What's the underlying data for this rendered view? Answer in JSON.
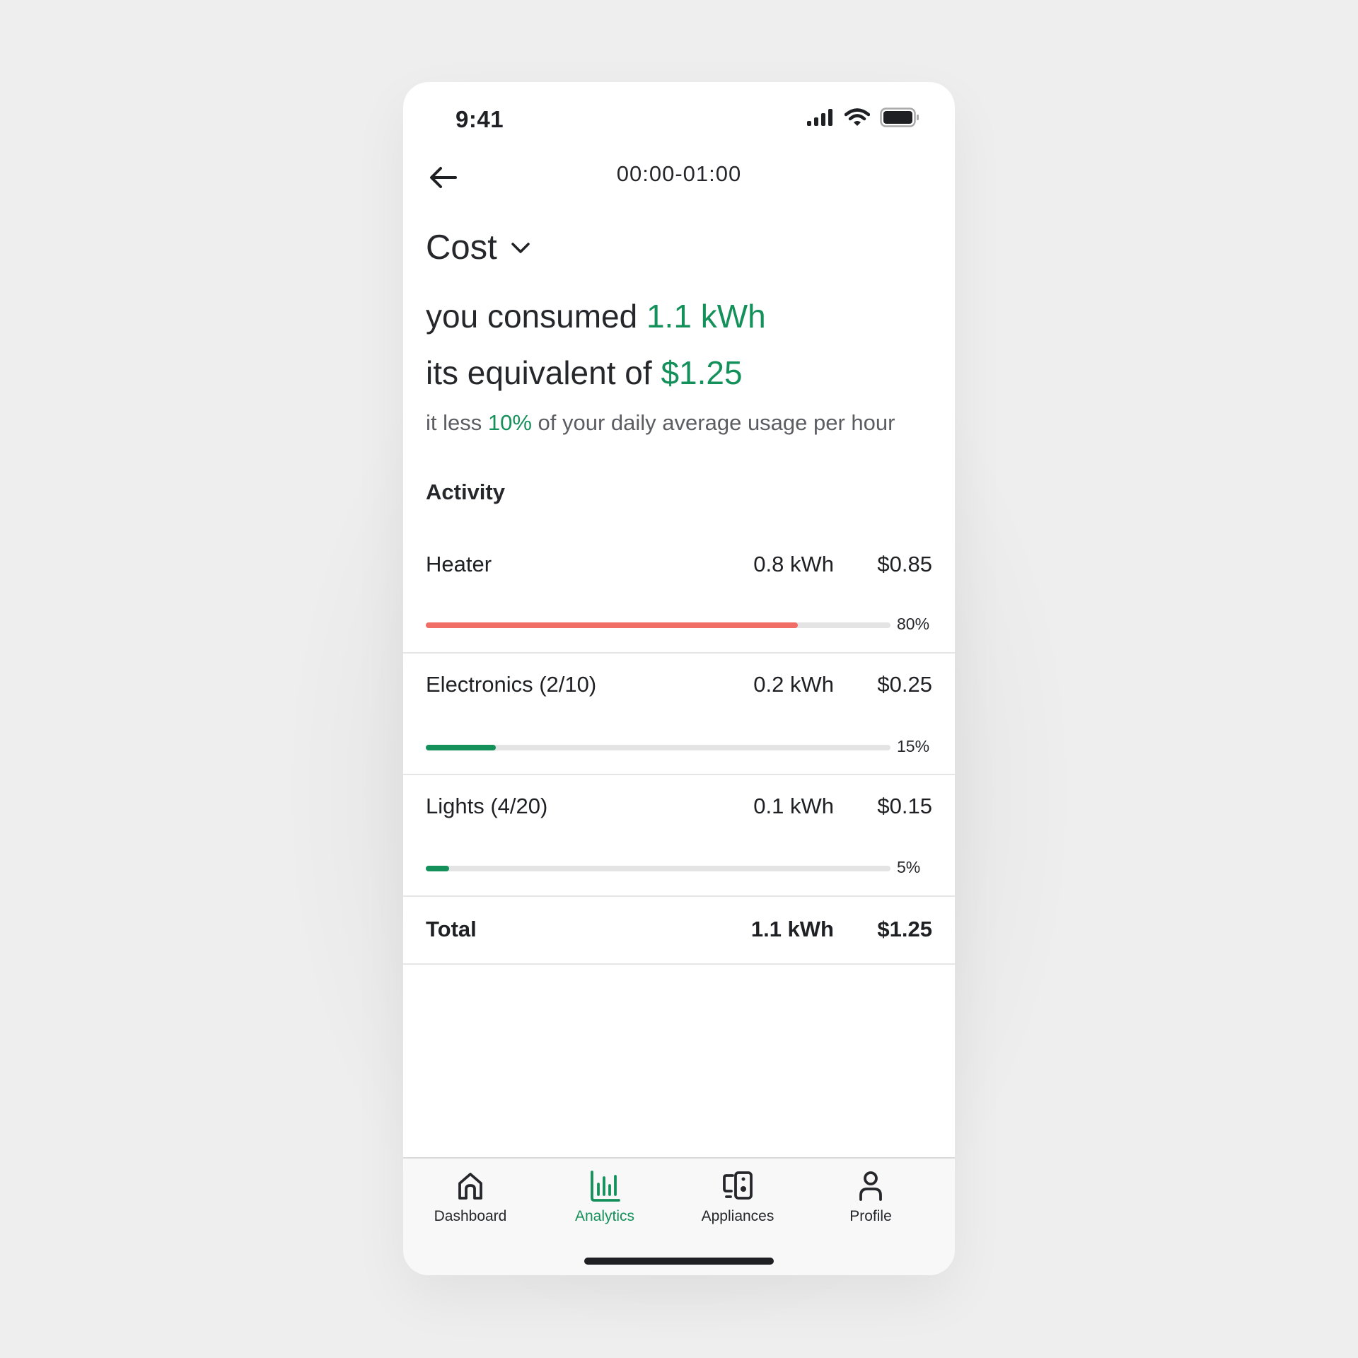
{
  "status_bar": {
    "time": "9:41",
    "icons": [
      "cellular-signal-icon",
      "wifi-icon",
      "battery-icon"
    ]
  },
  "header": {
    "back_icon": "arrow-left-icon",
    "title": "00:00-01:00"
  },
  "metric_selector": {
    "label": "Cost",
    "icon": "chevron-down-icon"
  },
  "summary": {
    "consumed_prefix": "you consumed",
    "consumed_value": "1.1 kWh",
    "equivalent_prefix": "its equivalent of",
    "equivalent_value": "$1.25",
    "comparison_prefix": "it less",
    "comparison_value": "10%",
    "comparison_suffix": "of your daily average usage per hour"
  },
  "activity": {
    "title": "Activity",
    "items": [
      {
        "label": "Heater",
        "kwh": "0.8 kWh",
        "cost": "$0.85",
        "percent_label": "80%",
        "percent": 80,
        "color": "#f06e66"
      },
      {
        "label": "Electronics (2/10)",
        "kwh": "0.2 kWh",
        "cost": "$0.25",
        "percent_label": "15%",
        "percent": 15,
        "color": "#14905a"
      },
      {
        "label": "Lights (4/20)",
        "kwh": "0.1 kWh",
        "cost": "$0.15",
        "percent_label": "5%",
        "percent": 5,
        "color": "#14905a"
      }
    ],
    "total": {
      "label": "Total",
      "kwh": "1.1 kWh",
      "cost": "$1.25"
    }
  },
  "bottom_nav": {
    "items": [
      {
        "label": "Dashboard",
        "icon": "home-icon",
        "active": false
      },
      {
        "label": "Analytics",
        "icon": "bar-chart-icon",
        "active": true
      },
      {
        "label": "Appliances",
        "icon": "devices-icon",
        "active": false
      },
      {
        "label": "Profile",
        "icon": "user-icon",
        "active": false
      }
    ]
  },
  "colors": {
    "accent": "#14905a",
    "alert": "#f06e66",
    "track": "#e4e4e4",
    "text": "#1f2023",
    "background": "#eeeeee"
  }
}
